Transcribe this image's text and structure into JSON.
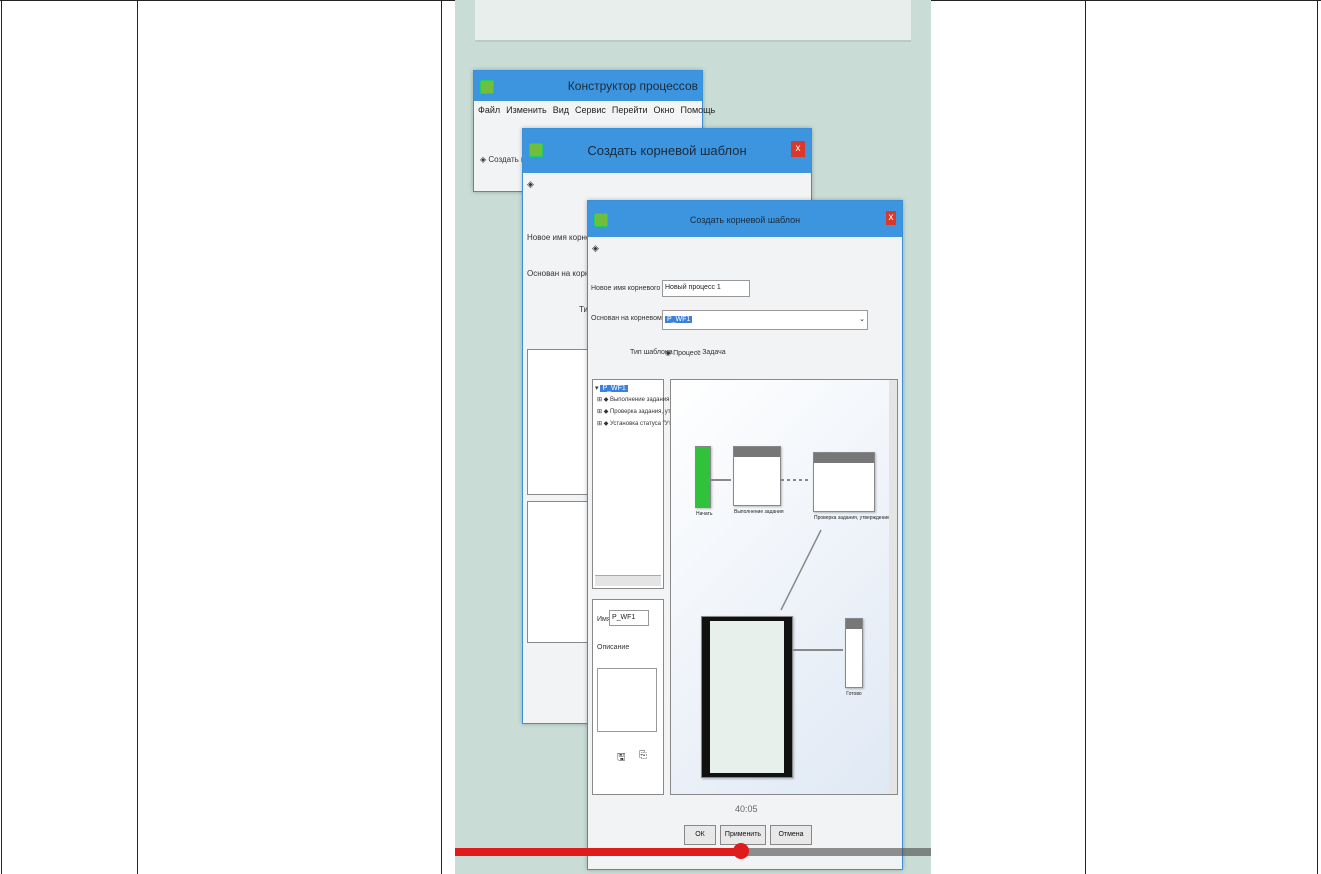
{
  "video": {
    "progress": 0.6,
    "time_overlay": "40:05"
  },
  "bg_window": {
    "title": "Конструктор процессов",
    "menu": [
      "Файл",
      "Изменить",
      "Вид",
      "Сервис",
      "Перейти",
      "Окно",
      "Помощь"
    ],
    "toolbar_label": "Создать ко"
  },
  "mid_dialog": {
    "title": "Создать корневой шаблон",
    "close": "x",
    "label_new_name": "Новое имя корневого",
    "label_based_on": "Основан на корневом",
    "label_type": "Тип"
  },
  "front_dialog": {
    "title": "Создать корневой шаблон",
    "close": "x",
    "label_new_name": "Новое имя корневого шаблона",
    "new_name_value": "Новый процесс 1",
    "label_based_on": "Основан на корневом шаблоне",
    "based_on_value": "P_WF1",
    "label_type": "Тип шаблона",
    "radio_process": "Процесс",
    "radio_task": "Задача",
    "tree": [
      "P_WF1",
      "Выполнение задания",
      "Проверка задания, утверж",
      "Установка статуса \"Утверж"
    ],
    "props_name_label": "Имя",
    "props_name_value": "P_WF1",
    "props_desc_label": "Описание",
    "nodes": {
      "start": "Начать",
      "task": "Выполнение задания",
      "check": "Проверка задания, утверждение",
      "done": "Готово"
    },
    "buttons": {
      "ok": "ОК",
      "apply": "Применить",
      "cancel": "Отмена"
    }
  },
  "colors": {
    "titlebar": "#3d95e0",
    "close": "#d9382b",
    "progress": "#e01b1b",
    "start_node": "#2fc23a"
  }
}
